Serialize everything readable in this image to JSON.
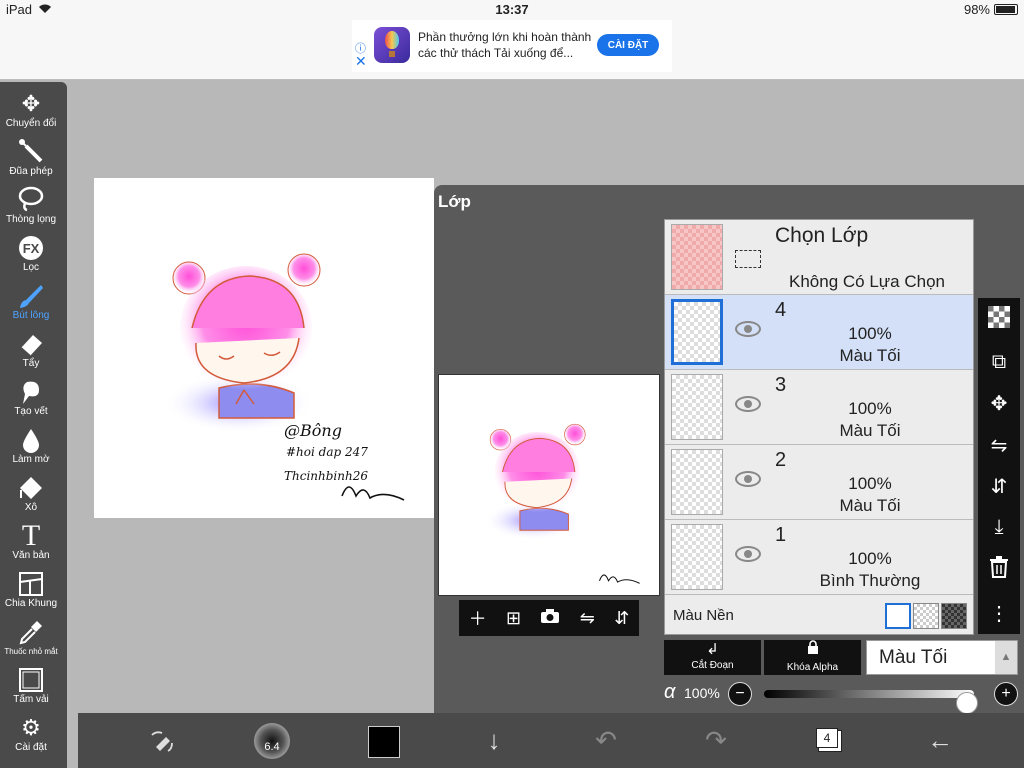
{
  "status": {
    "device": "iPad",
    "time": "13:37",
    "battery": "98%"
  },
  "ad": {
    "text": "Phần thưởng lớn khi hoàn thành các thử thách Tải xuống để...",
    "button": "CÀI ĐẶT"
  },
  "tools": [
    {
      "label": "Chuyển đổi",
      "icon": "move-arrows-icon"
    },
    {
      "label": "Đũa phép",
      "icon": "magic-wand-icon"
    },
    {
      "label": "Thòng lọng",
      "icon": "lasso-icon"
    },
    {
      "label": "Lọc",
      "icon": "fx-filter-icon"
    },
    {
      "label": "Bút lông",
      "icon": "brush-icon",
      "active": true
    },
    {
      "label": "Tẩy",
      "icon": "eraser-icon"
    },
    {
      "label": "Tạo vết",
      "icon": "smudge-icon"
    },
    {
      "label": "Làm mờ",
      "icon": "blur-drop-icon"
    },
    {
      "label": "Xô",
      "icon": "bucket-icon"
    },
    {
      "label": "Văn bản",
      "icon": "text-icon"
    },
    {
      "label": "Chia Khung",
      "icon": "frame-divider-icon"
    },
    {
      "label": "Thuốc nhỏ mắt",
      "icon": "eyedropper-icon"
    },
    {
      "label": "Tấm vải",
      "icon": "canvas-icon"
    },
    {
      "label": "Cài đặt",
      "icon": "gear-icon"
    }
  ],
  "artwork": {
    "sig_line1": "@Bông",
    "sig_line2": "#hoi dap 247",
    "sig_line3": "Thcinhbinh26"
  },
  "panel": {
    "title": "Lớp",
    "selection": {
      "title": "Chọn Lớp",
      "subtitle": "Không Có Lựa Chọn"
    },
    "layers": [
      {
        "number": "4",
        "opacity": "100%",
        "mode": "Màu Tối",
        "selected": true
      },
      {
        "number": "3",
        "opacity": "100%",
        "mode": "Màu Tối"
      },
      {
        "number": "2",
        "opacity": "100%",
        "mode": "Màu Tối"
      },
      {
        "number": "1",
        "opacity": "100%",
        "mode": "Bình Thường"
      }
    ],
    "background_label": "Màu Nền",
    "cut_label": "Cắt Đoạn",
    "alpha_lock_label": "Khóa Alpha",
    "blend_mode": "Màu Tối",
    "alpha_symbol": "α",
    "alpha_value": "100%",
    "alpha_level": 1.0
  },
  "bottom": {
    "brush_size": "6.4",
    "layer_count": "4",
    "color": "#000000"
  },
  "colors": {
    "accent": "#4da3ff",
    "selected_row": "#d4e0f7",
    "selected_border": "#1f6fd6"
  }
}
